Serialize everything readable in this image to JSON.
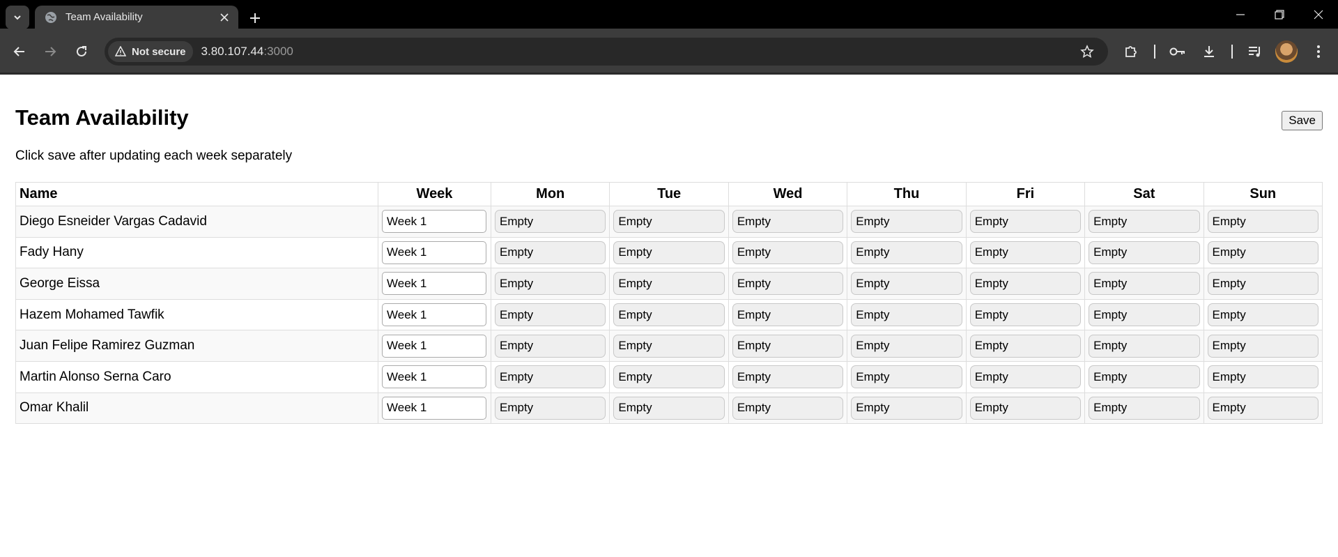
{
  "browser": {
    "tab_title": "Team Availability",
    "security_label": "Not secure",
    "url_host": "3.80.107.44",
    "url_port": ":3000"
  },
  "page": {
    "title": "Team Availability",
    "save_label": "Save",
    "subtitle": "Click save after updating each week separately"
  },
  "table": {
    "headers": [
      "Name",
      "Week",
      "Mon",
      "Tue",
      "Wed",
      "Thu",
      "Fri",
      "Sat",
      "Sun"
    ],
    "rows": [
      {
        "name": "Diego Esneider Vargas Cadavid",
        "week": "Week 1",
        "days": [
          "Empty",
          "Empty",
          "Empty",
          "Empty",
          "Empty",
          "Empty",
          "Empty"
        ]
      },
      {
        "name": "Fady Hany",
        "week": "Week 1",
        "days": [
          "Empty",
          "Empty",
          "Empty",
          "Empty",
          "Empty",
          "Empty",
          "Empty"
        ]
      },
      {
        "name": "George Eissa",
        "week": "Week 1",
        "days": [
          "Empty",
          "Empty",
          "Empty",
          "Empty",
          "Empty",
          "Empty",
          "Empty"
        ]
      },
      {
        "name": "Hazem Mohamed Tawfik",
        "week": "Week 1",
        "days": [
          "Empty",
          "Empty",
          "Empty",
          "Empty",
          "Empty",
          "Empty",
          "Empty"
        ]
      },
      {
        "name": "Juan Felipe Ramirez Guzman",
        "week": "Week 1",
        "days": [
          "Empty",
          "Empty",
          "Empty",
          "Empty",
          "Empty",
          "Empty",
          "Empty"
        ]
      },
      {
        "name": "Martin Alonso Serna Caro",
        "week": "Week 1",
        "days": [
          "Empty",
          "Empty",
          "Empty",
          "Empty",
          "Empty",
          "Empty",
          "Empty"
        ]
      },
      {
        "name": "Omar Khalil",
        "week": "Week 1",
        "days": [
          "Empty",
          "Empty",
          "Empty",
          "Empty",
          "Empty",
          "Empty",
          "Empty"
        ]
      }
    ]
  }
}
